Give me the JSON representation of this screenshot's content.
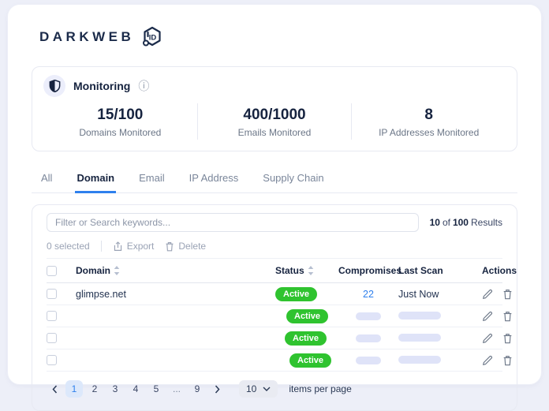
{
  "brand": {
    "name": "DARKWEB",
    "badge": "ID"
  },
  "monitoring": {
    "title": "Monitoring",
    "stats": [
      {
        "value": "15/100",
        "label": "Domains Monitored"
      },
      {
        "value": "400/1000",
        "label": "Emails Monitored"
      },
      {
        "value": "8",
        "label": "IP Addresses Monitored"
      }
    ]
  },
  "tabs": [
    {
      "label": "All"
    },
    {
      "label": "Domain"
    },
    {
      "label": "Email"
    },
    {
      "label": "IP Address"
    },
    {
      "label": "Supply Chain"
    }
  ],
  "active_tab": "Domain",
  "search": {
    "placeholder": "Filter or Search keywords..."
  },
  "results": {
    "count": "10",
    "of_word": "of",
    "total": "100",
    "label": "Results"
  },
  "toolbar": {
    "selected": "0 selected",
    "export_label": "Export",
    "delete_label": "Delete"
  },
  "table": {
    "columns": {
      "domain": "Domain",
      "status": "Status",
      "compromises": "Compromises",
      "last_scan": "Last Scan",
      "actions": "Actions"
    },
    "rows": [
      {
        "domain": "glimpse.net",
        "status": "Active",
        "compromises": "22",
        "last_scan": "Just Now",
        "loading": false
      },
      {
        "domain": "",
        "status": "Active",
        "compromises": "",
        "last_scan": "",
        "loading": true
      },
      {
        "domain": "",
        "status": "Active",
        "compromises": "",
        "last_scan": "",
        "loading": true
      },
      {
        "domain": "",
        "status": "Active",
        "compromises": "",
        "last_scan": "",
        "loading": true
      }
    ]
  },
  "pagination": {
    "pages": [
      "1",
      "2",
      "3",
      "4",
      "5",
      "...",
      "9"
    ],
    "active_page": "1",
    "per_page": "10",
    "per_page_label": "items per page"
  },
  "colors": {
    "accent_blue": "#2f80ed",
    "status_green": "#2fc32f",
    "brand_navy": "#1b2b4a",
    "skeleton": "#dfe3f8",
    "page_background": "#edeff8"
  }
}
